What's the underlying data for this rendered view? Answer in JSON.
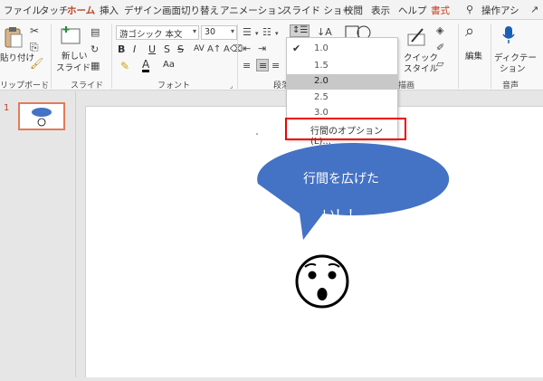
{
  "tabs": [
    "ファイル",
    "タッチ",
    "ホーム",
    "挿入",
    "デザイン",
    "画面切り替え",
    "アニメーション",
    "スライド ショー",
    "校閲",
    "表示",
    "ヘルプ",
    "書式",
    "操作アシ"
  ],
  "clipboard": {
    "paste": "貼り付け",
    "label": "リップボード"
  },
  "slides_group": {
    "new_slide_line1": "新しい",
    "new_slide_line2": "スライド",
    "label": "スライド"
  },
  "font": {
    "name": "游ゴシック 本文",
    "size": "30",
    "label": "フォント",
    "bold": "B",
    "italic": "I",
    "underline": "U",
    "strike": "S",
    "shadow": "S",
    "spacing": "AV",
    "font_color": "A",
    "aa": "Aa"
  },
  "paragraph": {
    "label": "段落"
  },
  "drawing": {
    "quick_style_line1": "クイック",
    "quick_style_line2": "スタイル",
    "label": "描画"
  },
  "editing": {
    "label": "編集"
  },
  "voice": {
    "dictate_line1": "ディクテー",
    "dictate_line2": "ション",
    "label": "音声"
  },
  "line_spacing_menu": {
    "items": [
      "1.0",
      "1.5",
      "2.0",
      "2.5",
      "3.0"
    ],
    "checked": "1.0",
    "highlighted": "2.0",
    "options": "行間のオプション(L)..."
  },
  "slide_panel": {
    "number": "1"
  },
  "slide": {
    "bubble_line1": "行間を広げた",
    "bubble_line2": "い！！"
  },
  "colors": {
    "accent": "#b7472a",
    "bubble": "#4472c4",
    "highlight_box": "#e00000"
  }
}
